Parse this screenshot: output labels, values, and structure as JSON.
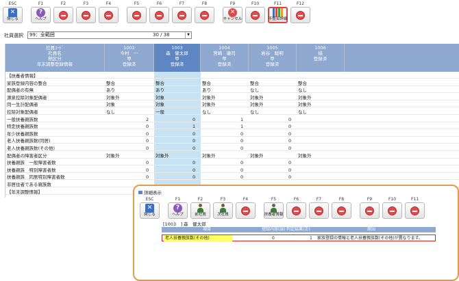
{
  "toolbar": {
    "keys": [
      {
        "cap": "ESC",
        "label": "閉じる",
        "icon": "quit-icon"
      },
      {
        "cap": "F1",
        "label": "ヘルプ",
        "icon": "help-icon"
      },
      {
        "cap": "F2",
        "label": "",
        "icon": "disabled-icon"
      },
      {
        "cap": "F3",
        "label": "",
        "icon": "disabled-icon"
      },
      {
        "cap": "F4",
        "label": "",
        "icon": "disabled-icon"
      },
      {
        "cap": "F5",
        "label": "",
        "icon": "disabled-icon"
      },
      {
        "cap": "F6",
        "label": "",
        "icon": "disabled-icon"
      },
      {
        "cap": "F7",
        "label": "",
        "icon": "disabled-icon"
      },
      {
        "cap": "F8",
        "label": "",
        "icon": "disabled-icon"
      },
      {
        "cap": "F9",
        "label": "キャンセル",
        "icon": "cancel-icon"
      },
      {
        "cap": "F10",
        "label": "",
        "icon": "disabled-icon"
      },
      {
        "cap": "F11",
        "label": "不整合詳細",
        "icon": "binders-icon",
        "active": true
      },
      {
        "cap": "F12",
        "label": "",
        "icon": "disabled-icon"
      }
    ]
  },
  "employee_select": {
    "label": "社員選択",
    "value": "99：全範囲",
    "count": "30 / 38"
  },
  "grid": {
    "header_labels": [
      "社員ｺｰﾄﾞ",
      "社員名",
      "税区分",
      "年末調整登録情報"
    ],
    "columns": [
      {
        "code": "1002",
        "name": "今村　一",
        "tax": "甲",
        "status": "登録済"
      },
      {
        "code": "1003",
        "name": "森　健太郎",
        "tax": "甲",
        "status": "登録済"
      },
      {
        "code": "1004",
        "name": "宮崎　康司",
        "tax": "甲",
        "status": "登録済"
      },
      {
        "code": "1005",
        "name": "岩谷　聡明",
        "tax": "甲",
        "status": "登録済"
      },
      {
        "code": "1006",
        "name": "楢　",
        "tax": "",
        "status": "登録済"
      }
    ],
    "rows": [
      {
        "label": "【扶養者情報】",
        "values": [
          "",
          "",
          "",
          "",
          ""
        ]
      },
      {
        "label": "家族登録内容の整合",
        "values": [
          "整合",
          "整合",
          "整合",
          "整合",
          "整合"
        ]
      },
      {
        "label": "配偶者の有無",
        "values": [
          "あり",
          "あり",
          "あり",
          "なし",
          "なし"
        ]
      },
      {
        "label": "源泉控除対象配偶者",
        "values": [
          "対象外",
          "対象",
          "対象外",
          "対象外",
          "対象外"
        ]
      },
      {
        "label": "同一生計配偶者",
        "values": [
          "対象",
          "対象",
          "対象外",
          "対象外",
          "対象外"
        ]
      },
      {
        "label": "控除対象配偶者",
        "values": [
          "なし",
          "一般",
          "なし",
          "なし",
          "なし"
        ]
      },
      {
        "label": "一般扶養親族数",
        "values": [
          "2",
          "0",
          "1",
          "0",
          ""
        ]
      },
      {
        "label": "特定扶養親族数",
        "values": [
          "0",
          "1",
          "1",
          "0",
          ""
        ]
      },
      {
        "label": "年少扶養親族数",
        "values": [
          "0",
          "0",
          "0",
          "0",
          ""
        ]
      },
      {
        "label": "老人扶養親族数(同居)",
        "values": [
          "0",
          "0",
          "0",
          "0",
          ""
        ]
      },
      {
        "label": "老人扶養親族数(その他)",
        "values": [
          "0",
          "0",
          "0",
          "0",
          ""
        ]
      },
      {
        "label": "配偶者の障害者区分",
        "values": [
          "対象外",
          "対象外",
          "対象外",
          "対象外",
          "対象外"
        ]
      },
      {
        "label": "扶養親族　一般障害者数",
        "values": [
          "0",
          "0",
          "0",
          "0",
          ""
        ]
      },
      {
        "label": "扶養親族　特別障害者数",
        "values": [
          "0",
          "0",
          "0",
          "0",
          ""
        ]
      },
      {
        "label": "扶養親族　同居特別障害者数",
        "values": [
          "0",
          "0",
          "0",
          "0",
          ""
        ]
      },
      {
        "label": "非居住者である親族数",
        "values": [
          "",
          "",
          "",
          "",
          ""
        ]
      },
      {
        "label": "【年末調整情報】",
        "values": [
          "",
          "",
          "",
          "",
          ""
        ]
      }
    ]
  },
  "dialog": {
    "title": "詳細表示",
    "keys": [
      {
        "cap": "ESC",
        "label": "閉じる",
        "icon": "quit-icon"
      },
      {
        "cap": "F1",
        "label": "ヘルプ",
        "icon": "help-icon"
      },
      {
        "cap": "F2",
        "label": "前社員",
        "icon": "person-icon"
      },
      {
        "cap": "F3",
        "label": "次社員",
        "icon": "person-icon"
      },
      {
        "cap": "F4",
        "label": "",
        "icon": "disabled-icon"
      },
      {
        "cap": "F5",
        "label": "扶養者情報",
        "icon": "person-icon"
      },
      {
        "cap": "F6",
        "label": "",
        "icon": "disabled-icon"
      },
      {
        "cap": "F7",
        "label": "",
        "icon": "disabled-icon"
      },
      {
        "cap": "F8",
        "label": "",
        "icon": "disabled-icon"
      },
      {
        "cap": "F9",
        "label": "",
        "icon": "disabled-icon"
      },
      {
        "cap": "F10",
        "label": "",
        "icon": "disabled-icon"
      },
      {
        "cap": "F11",
        "label": "",
        "icon": "disabled-icon"
      }
    ],
    "employee": "[1003　] 森　健太郎",
    "headers": [
      "項目",
      "登録内容(誤)",
      "判定結果(正)",
      "原因"
    ],
    "row": {
      "item": "老人扶養親族数(その他)",
      "registered": "0",
      "judged": "1",
      "cause": "家族登録の情報と老人扶養親族数(その他)が異なります。"
    }
  }
}
